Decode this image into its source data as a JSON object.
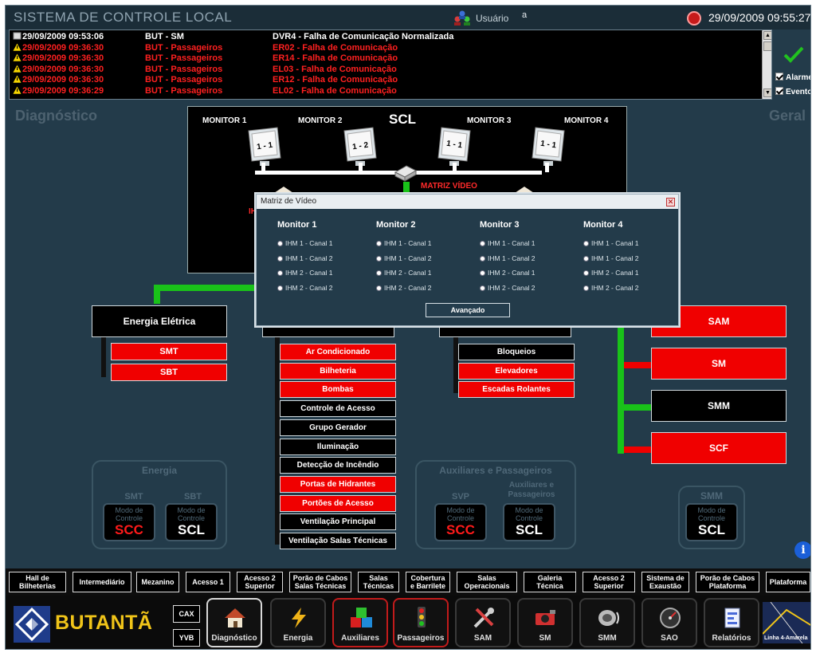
{
  "header": {
    "app_title": "SISTEMA DE CONTROLE LOCAL",
    "user_label": "Usuário",
    "user_value": "a",
    "datetime": "29/09/2009 09:55:27"
  },
  "alarms": [
    {
      "time": "29/09/2009 09:53:06",
      "source": "BUT - SM",
      "message": "DVR4 - Falha de Comunicação Normalizada",
      "severity": "normal"
    },
    {
      "time": "29/09/2009 09:36:30",
      "source": "BUT - Passageiros",
      "message": "ER02 - Falha de Comunicação",
      "severity": "alarm"
    },
    {
      "time": "29/09/2009 09:36:30",
      "source": "BUT - Passageiros",
      "message": "ER14 - Falha de Comunicação",
      "severity": "alarm"
    },
    {
      "time": "29/09/2009 09:36:30",
      "source": "BUT - Passageiros",
      "message": "EL03 - Falha de Comunicação",
      "severity": "alarm"
    },
    {
      "time": "29/09/2009 09:36:30",
      "source": "BUT - Passageiros",
      "message": "ER12 - Falha de Comunicação",
      "severity": "alarm"
    },
    {
      "time": "29/09/2009 09:36:29",
      "source": "BUT - Passageiros",
      "message": "EL02 - Falha de Comunicação",
      "severity": "alarm"
    }
  ],
  "filters": {
    "alarms_label": "Alarmes",
    "events_label": "Eventos"
  },
  "side_headings": {
    "left": "Diagnóstico",
    "right": "Geral"
  },
  "scl_panel": {
    "title": "SCL",
    "monitors": [
      "MONITOR 1",
      "MONITOR 2",
      "MONITOR 3",
      "MONITOR 4"
    ],
    "screens": [
      "1 - 1",
      "1 - 2",
      "1 - 1",
      "1 - 1"
    ],
    "matrix_label": "MATRIZ VÍDEO",
    "partial_red_text": "IH"
  },
  "energia_eletrica": {
    "title": "Energia Elétrica",
    "items": [
      {
        "label": "SMT",
        "state": "alarm"
      },
      {
        "label": "SBT",
        "state": "alarm"
      }
    ]
  },
  "auxiliares_list": [
    {
      "label": "Ar Condicionado",
      "state": "alarm"
    },
    {
      "label": "Bilheteria",
      "state": "alarm"
    },
    {
      "label": "Bombas",
      "state": "alarm"
    },
    {
      "label": "Controle de Acesso",
      "state": "normal"
    },
    {
      "label": "Grupo Gerador",
      "state": "normal"
    },
    {
      "label": "Iluminação",
      "state": "normal"
    },
    {
      "label": "Detecção de Incêndio",
      "state": "normal"
    },
    {
      "label": "Portas de Hidrantes",
      "state": "alarm"
    },
    {
      "label": "Portões de Acesso",
      "state": "alarm"
    },
    {
      "label": "Ventilação Principal",
      "state": "normal"
    },
    {
      "label": "Ventilação Salas Técnicas",
      "state": "normal"
    }
  ],
  "passageiros_list": [
    {
      "label": "Bloqueios",
      "state": "normal"
    },
    {
      "label": "Elevadores",
      "state": "alarm"
    },
    {
      "label": "Escadas Rolantes",
      "state": "alarm"
    }
  ],
  "right_list": [
    {
      "label": "SAM",
      "state": "alarm"
    },
    {
      "label": "SM",
      "state": "alarm"
    },
    {
      "label": "SMM",
      "state": "normal"
    },
    {
      "label": "SCF",
      "state": "alarm"
    }
  ],
  "mode_groups": {
    "mode_caption_1": "Modo de",
    "mode_caption_2": "Controle",
    "energia": {
      "title": "Energia",
      "items": [
        {
          "label": "SMT",
          "value": "SCC"
        },
        {
          "label": "SBT",
          "value": "SCL"
        }
      ]
    },
    "aux_pass": {
      "title": "Auxiliares e Passageiros",
      "items": [
        {
          "label": "SVP",
          "value": "SCC"
        },
        {
          "label": "Auxiliares e Passageiros",
          "value": "SCL"
        }
      ]
    },
    "smm": {
      "title": "SMM",
      "items": [
        {
          "label": "",
          "value": "SCL"
        }
      ]
    }
  },
  "dialog": {
    "title": "Matriz de Vídeo",
    "close": "✕",
    "columns": [
      {
        "heading": "Monitor 1",
        "options": [
          "IHM 1 - Canal 1",
          "IHM 1 - Canal 2",
          "IHM 2 - Canal 1",
          "IHM 2 - Canal 2"
        ]
      },
      {
        "heading": "Monitor 2",
        "options": [
          "IHM 1 - Canal 1",
          "IHM 1 - Canal 2",
          "IHM 2 - Canal 1",
          "IHM 2 - Canal 2"
        ]
      },
      {
        "heading": "Monitor 3",
        "options": [
          "IHM 1 - Canal 1",
          "IHM 1 - Canal 2",
          "IHM 2 - Canal 1",
          "IHM 2 - Canal 2"
        ]
      },
      {
        "heading": "Monitor 4",
        "options": [
          "IHM 1 - Canal 1",
          "IHM 1 - Canal 2",
          "IHM 2 - Canal 1",
          "IHM 2 - Canal 2"
        ]
      }
    ],
    "advanced_label": "Avançado"
  },
  "info_label": "i",
  "nav_top": [
    "Hall de\nBilheterias",
    "Intermediário",
    "Mezanino",
    "Acesso 1",
    "Acesso 2\nSuperior",
    "Porão de Cabos\nSalas Técnicas",
    "Salas\nTécnicas",
    "Cobertura\ne Barrilete",
    "Salas\nOperacionais",
    "Galeria\nTécnica",
    "Acesso 2\nSuperior",
    "Sistema de\nExaustão",
    "Porão de Cabos\nPlataforma",
    "Plataforma"
  ],
  "brand": {
    "name": "BUTANTÃ",
    "cax": "CAX",
    "yvb": "YVB",
    "line_logo": "Linha 4-Amarela"
  },
  "nav_bottom": [
    {
      "label": "Diagnóstico",
      "icon": "house-icon",
      "state": "active"
    },
    {
      "label": "Energia",
      "icon": "lightning-icon",
      "state": "normal"
    },
    {
      "label": "Auxiliares",
      "icon": "cubes-icon",
      "state": "alarm"
    },
    {
      "label": "Passageiros",
      "icon": "traffic-light-icon",
      "state": "alarm"
    },
    {
      "label": "SAM",
      "icon": "tools-icon",
      "state": "normal"
    },
    {
      "label": "SM",
      "icon": "camera-icon",
      "state": "normal"
    },
    {
      "label": "SMM",
      "icon": "speaker-icon",
      "state": "normal"
    },
    {
      "label": "SAO",
      "icon": "gauge-icon",
      "state": "normal"
    },
    {
      "label": "Relatórios",
      "icon": "report-icon",
      "state": "normal"
    }
  ],
  "colors": {
    "alarm": "#f00000",
    "normal": "#000000",
    "link_green": "#19c219",
    "background": "#233b4a",
    "brand_yellow": "#f0c419"
  }
}
